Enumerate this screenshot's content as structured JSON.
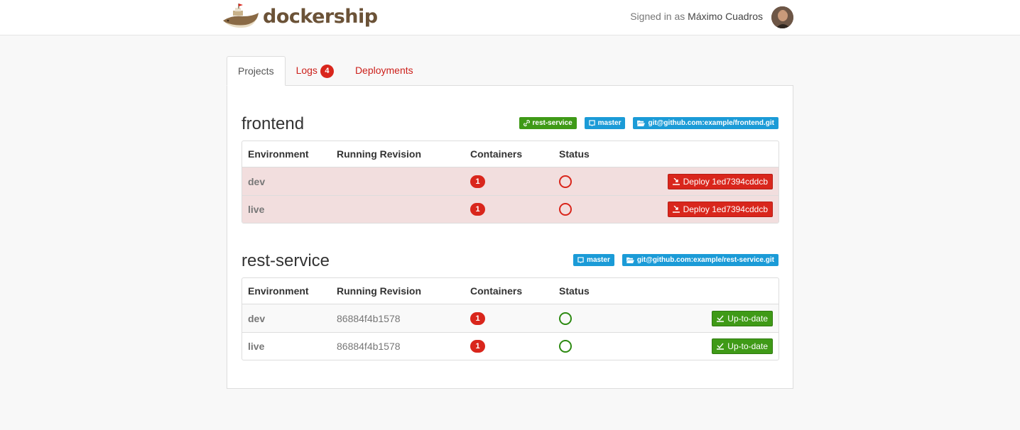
{
  "app": {
    "name": "dockership"
  },
  "header": {
    "signed_prefix": "Signed in as",
    "user_name": "Máximo Cuadros"
  },
  "tabs": [
    {
      "label": "Projects",
      "active": true
    },
    {
      "label": "Logs",
      "badge": "4",
      "active": false
    },
    {
      "label": "Deployments",
      "active": false
    }
  ],
  "columns": {
    "environment": "Environment",
    "revision": "Running Revision",
    "containers": "Containers",
    "status": "Status"
  },
  "projects": [
    {
      "name": "frontend",
      "labels": [
        {
          "text": "rest-service",
          "color": "#3f9a17",
          "icon": "link-icon"
        },
        {
          "text": "master",
          "color": "#1b9bd7",
          "icon": "branch-icon"
        },
        {
          "text": "git@github.com:example/frontend.git",
          "color": "#1b9bd7",
          "icon": "folder-icon"
        }
      ],
      "rows": [
        {
          "env": "dev",
          "revision": "",
          "containers": "1",
          "status": "error",
          "action": "Deploy 1ed7394cddcb"
        },
        {
          "env": "live",
          "revision": "",
          "containers": "1",
          "status": "error",
          "action": "Deploy 1ed7394cddcb"
        }
      ]
    },
    {
      "name": "rest-service",
      "labels": [
        {
          "text": "master",
          "color": "#1b9bd7",
          "icon": "branch-icon"
        },
        {
          "text": "git@github.com:example/rest-service.git",
          "color": "#1b9bd7",
          "icon": "folder-icon"
        }
      ],
      "rows": [
        {
          "env": "dev",
          "revision": "86884f4b1578",
          "containers": "1",
          "status": "ok",
          "action": "Up-to-date"
        },
        {
          "env": "live",
          "revision": "86884f4b1578",
          "containers": "1",
          "status": "ok",
          "action": "Up-to-date"
        }
      ]
    }
  ],
  "colors": {
    "accent": "#cc1f1a",
    "danger": "#d9261c",
    "success": "#3f9a17",
    "info": "#1b9bd7",
    "error_row": "#f2dede"
  }
}
